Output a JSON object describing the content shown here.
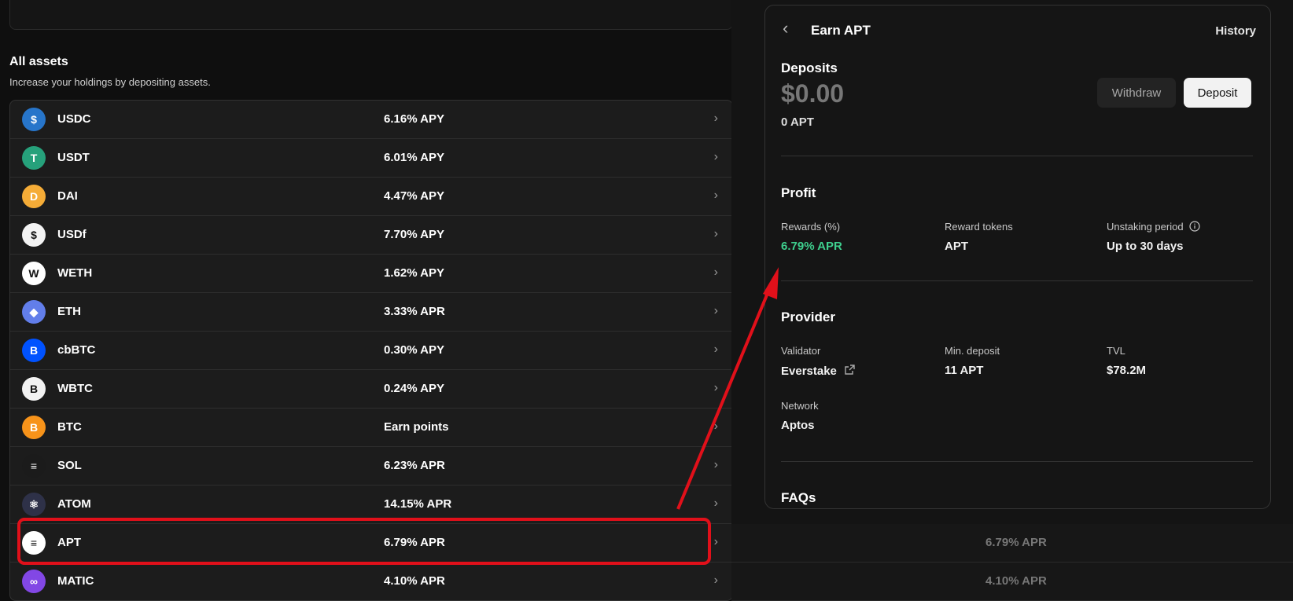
{
  "left": {
    "title": "All assets",
    "subtitle": "Increase your holdings by depositing assets.",
    "assets": [
      {
        "symbol": "USDC",
        "rate": "6.16% APY",
        "icon": "usdc-icon",
        "color": "#2775ca"
      },
      {
        "symbol": "USDT",
        "rate": "6.01% APY",
        "icon": "usdt-icon",
        "color": "#26a17b"
      },
      {
        "symbol": "DAI",
        "rate": "4.47% APY",
        "icon": "dai-icon",
        "color": "#f5ac37"
      },
      {
        "symbol": "USDf",
        "rate": "7.70% APY",
        "icon": "usdf-icon",
        "color": "#f3f3f3"
      },
      {
        "symbol": "WETH",
        "rate": "1.62% APY",
        "icon": "weth-icon",
        "color": "#ffffff"
      },
      {
        "symbol": "ETH",
        "rate": "3.33% APR",
        "icon": "eth-icon",
        "color": "#627eea"
      },
      {
        "symbol": "cbBTC",
        "rate": "0.30% APY",
        "icon": "cbbtc-icon",
        "color": "#0052ff"
      },
      {
        "symbol": "WBTC",
        "rate": "0.24% APY",
        "icon": "wbtc-icon",
        "color": "#f2f2f2"
      },
      {
        "symbol": "BTC",
        "rate": "Earn points",
        "icon": "btc-icon",
        "color": "#f7931a"
      },
      {
        "symbol": "SOL",
        "rate": "6.23% APR",
        "icon": "sol-icon",
        "color": "#1b1b1b"
      },
      {
        "symbol": "ATOM",
        "rate": "14.15% APR",
        "icon": "atom-icon",
        "color": "#2e3148"
      },
      {
        "symbol": "APT",
        "rate": "6.79% APR",
        "icon": "apt-icon",
        "color": "#ffffff"
      },
      {
        "symbol": "MATIC",
        "rate": "4.10% APR",
        "icon": "matic-icon",
        "color": "#8247e5"
      }
    ]
  },
  "background_rates": [
    "6.79% APR",
    "4.10% APR"
  ],
  "panel": {
    "title": "Earn APT",
    "history": "History",
    "deposits": {
      "heading": "Deposits",
      "amount": "$0.00",
      "amount_sub": "0 APT",
      "withdraw": "Withdraw",
      "deposit": "Deposit"
    },
    "profit": {
      "heading": "Profit",
      "rewards_label": "Rewards (%)",
      "rewards_value": "6.79% APR",
      "tokens_label": "Reward tokens",
      "tokens_value": "APT",
      "unstaking_label": "Unstaking period",
      "unstaking_value": "Up to 30 days"
    },
    "provider": {
      "heading": "Provider",
      "validator_label": "Validator",
      "validator_value": "Everstake",
      "min_label": "Min. deposit",
      "min_value": "11 APT",
      "tvl_label": "TVL",
      "tvl_value": "$78.2M",
      "network_label": "Network",
      "network_value": "Aptos"
    },
    "faqs": "FAQs"
  },
  "colors": {
    "accent_green": "#3ecf8e",
    "highlight_red": "#e1101a"
  }
}
